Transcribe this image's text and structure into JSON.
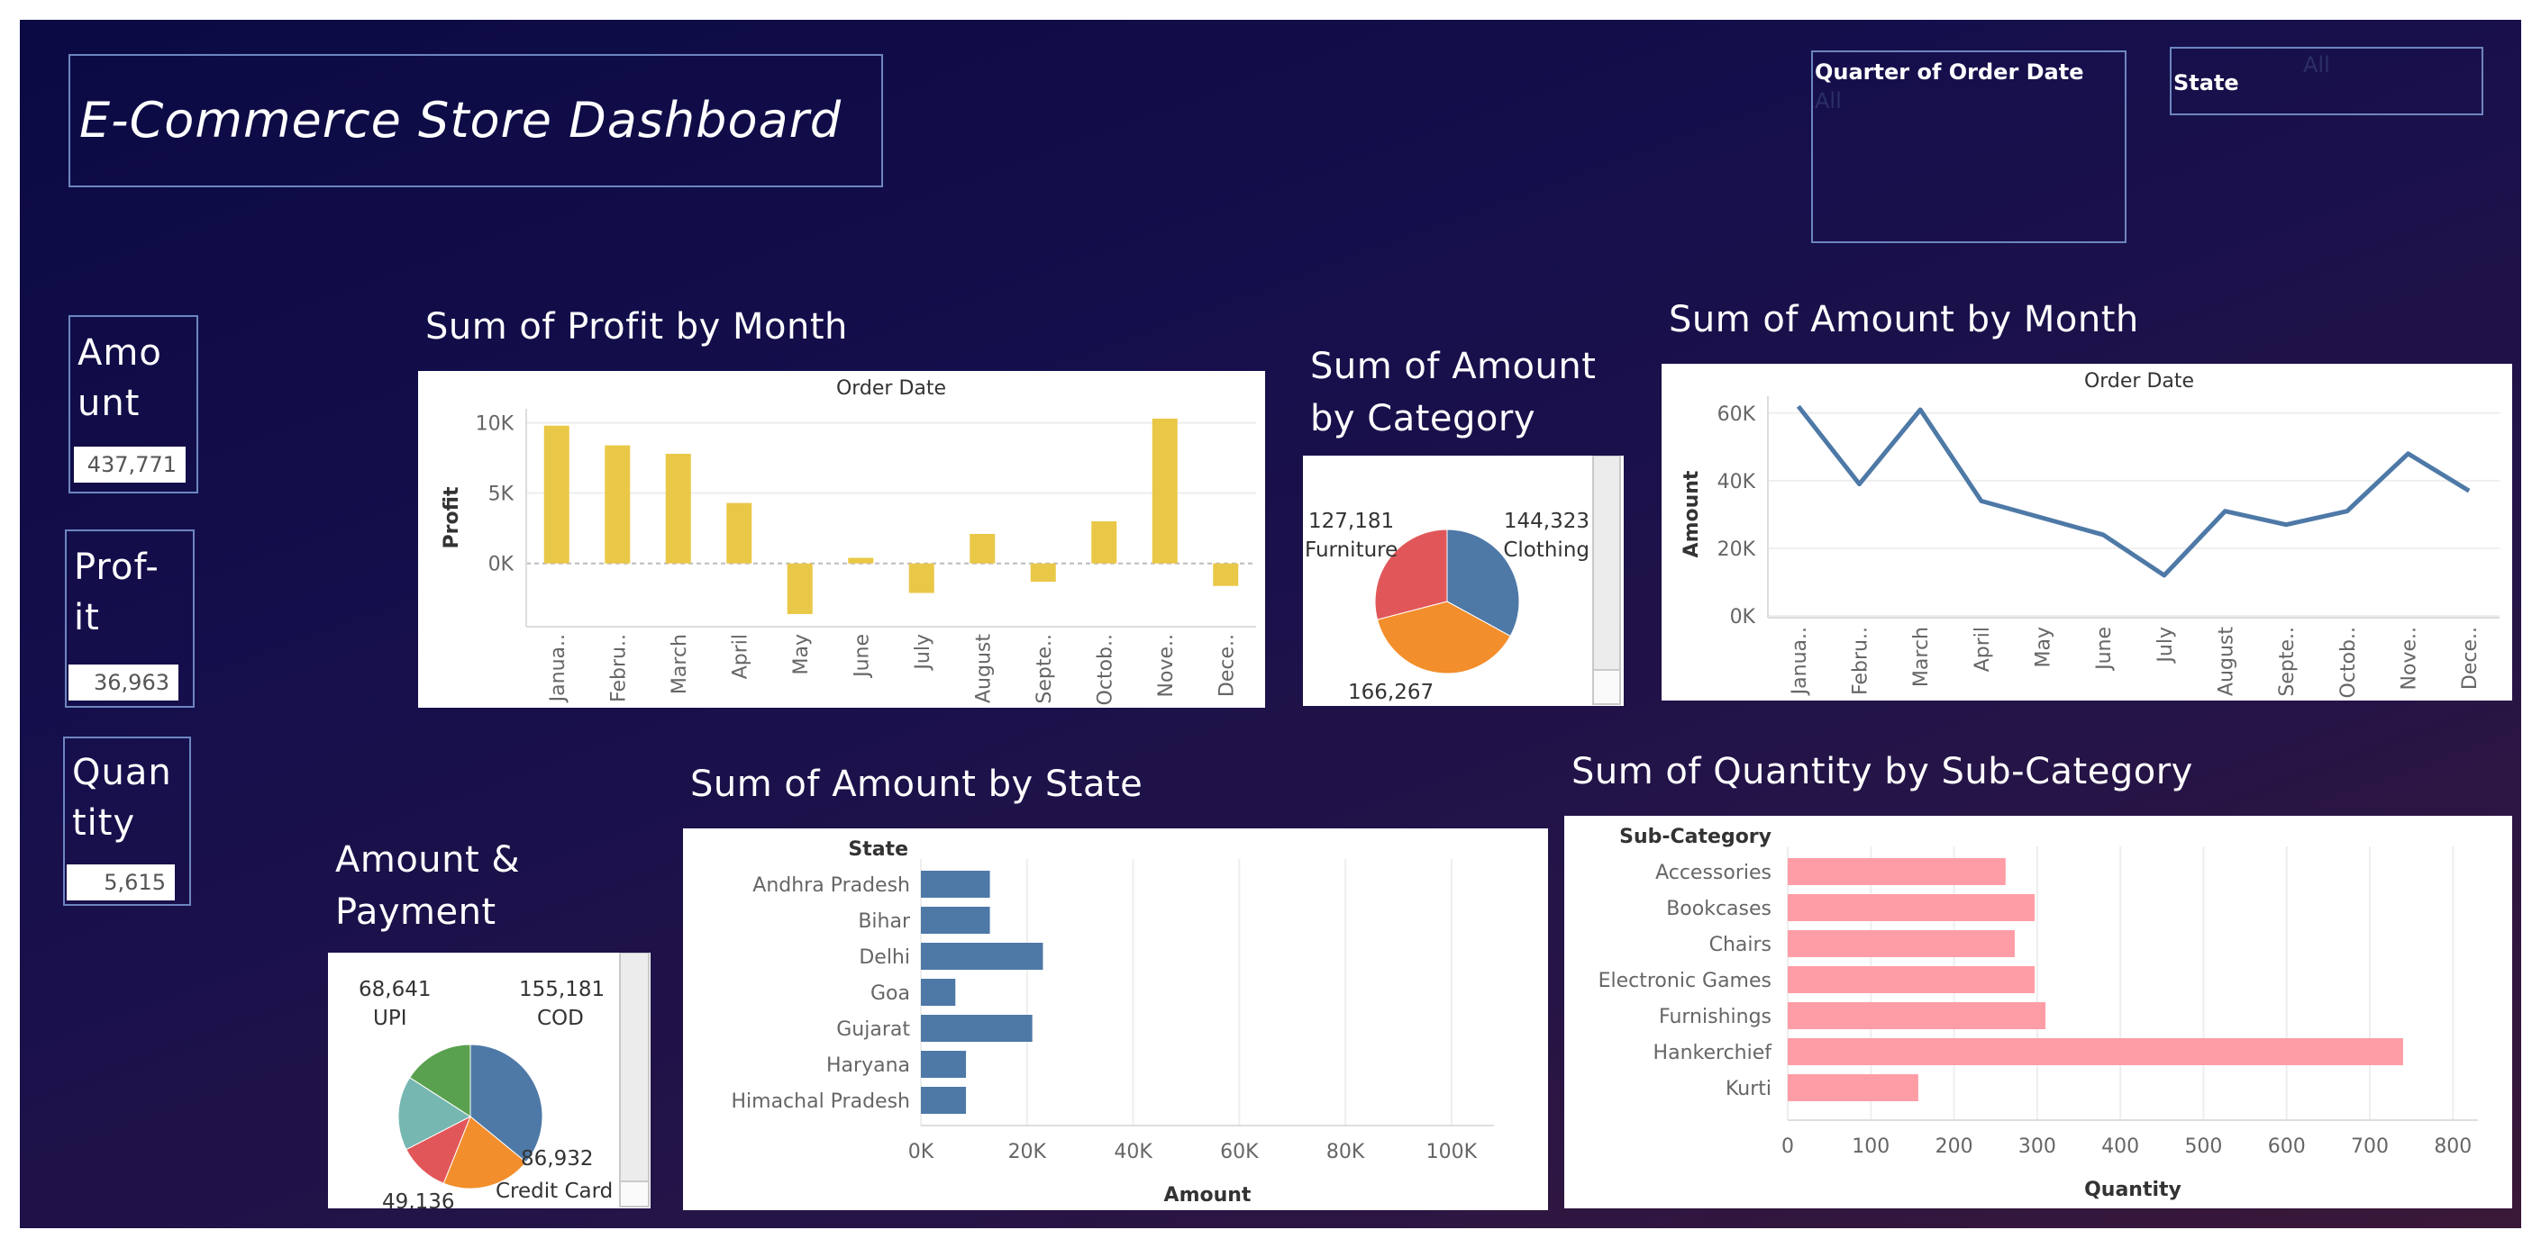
{
  "header": {
    "title": "E-Commerce Store Dashboard",
    "filters": [
      {
        "label": "Quarter of Order Date",
        "value": "All"
      },
      {
        "label": "State",
        "value": "All"
      }
    ]
  },
  "kpis": [
    {
      "label": "Amo\nunt",
      "value": "437,771"
    },
    {
      "label": "Prof-\nit",
      "value": "36,963"
    },
    {
      "label": "Quan\ntity",
      "value": "5,615"
    }
  ],
  "colors": {
    "yellow": "#eac847",
    "blue": "#4e79a7",
    "pink": "#ff9da7",
    "red": "#e15759",
    "orange": "#f28e2b",
    "green": "#59a14f",
    "teal": "#76b7b2"
  },
  "chart_data": [
    {
      "id": "profit_by_month",
      "type": "bar",
      "title": "Sum of Profit by Month",
      "xlabel": "Order Date",
      "ylabel": "Profit",
      "categories": [
        "Janua..",
        "Febru..",
        "March",
        "April",
        "May",
        "June",
        "July",
        "August",
        "Septe..",
        "Octob..",
        "Nove..",
        "Dece.."
      ],
      "values": [
        9800,
        8400,
        7800,
        4300,
        -3600,
        400,
        -2100,
        2100,
        -1300,
        3000,
        10300,
        -1600
      ],
      "yticks": [
        "10K",
        "5K",
        "0K"
      ],
      "ylim": [
        -4500,
        11000
      ],
      "color": "#eac847"
    },
    {
      "id": "amount_by_category",
      "type": "pie",
      "title": "Sum of Amount\nby Category",
      "slices": [
        {
          "label": "Clothing",
          "value": 144323,
          "value_text": "144,323",
          "color": "#4e79a7"
        },
        {
          "label": "",
          "value": 166267,
          "value_text": "166,267",
          "color": "#f28e2b"
        },
        {
          "label": "Furniture",
          "value": 127181,
          "value_text": "127,181",
          "color": "#e15759"
        }
      ]
    },
    {
      "id": "amount_by_month",
      "type": "line",
      "title": "Sum of Amount by Month",
      "xlabel": "Order Date",
      "ylabel": "Amount",
      "categories": [
        "Janua..",
        "Febru..",
        "March",
        "April",
        "May",
        "June",
        "July",
        "August",
        "Septe..",
        "Octob..",
        "Nove..",
        "Dece.."
      ],
      "values": [
        62000,
        39000,
        61000,
        34000,
        29000,
        24000,
        12000,
        31000,
        27000,
        31000,
        48000,
        37000
      ],
      "yticks": [
        "60K",
        "40K",
        "20K",
        "0K"
      ],
      "ylim": [
        0,
        65000
      ],
      "color": "#4e79a7"
    },
    {
      "id": "amount_and_payment",
      "type": "pie",
      "title": "Amount &\nPayment",
      "slices": [
        {
          "label": "COD",
          "value": 155181,
          "value_text": "155,181",
          "color": "#4e79a7"
        },
        {
          "label": "Credit Card",
          "value": 86932,
          "value_text": "86,932",
          "color": "#f28e2b"
        },
        {
          "label": "",
          "value": 49136,
          "value_text": "49,136",
          "color": "#e15759"
        },
        {
          "label": "",
          "value": 72000,
          "value_text": "",
          "color": "#76b7b2"
        },
        {
          "label": "UPI",
          "value": 68641,
          "value_text": "68,641",
          "color": "#59a14f"
        }
      ]
    },
    {
      "id": "amount_by_state",
      "type": "bar",
      "orientation": "horizontal",
      "title": "Sum of Amount by State",
      "dimension_header": "State",
      "xlabel": "Amount",
      "categories": [
        "Andhra Pradesh",
        "Bihar",
        "Delhi",
        "Goa",
        "Gujarat",
        "Haryana",
        "Himachal Pradesh"
      ],
      "values": [
        13000,
        13000,
        23000,
        6500,
        21000,
        8500,
        8500
      ],
      "xticks": [
        "0K",
        "20K",
        "40K",
        "60K",
        "80K",
        "100K"
      ],
      "xlim": [
        0,
        108000
      ],
      "color": "#4e79a7"
    },
    {
      "id": "quantity_by_subcategory",
      "type": "bar",
      "orientation": "horizontal",
      "title": "Sum of Quantity by Sub-Category",
      "dimension_header": "Sub-Category",
      "xlabel": "Quantity",
      "categories": [
        "Accessories",
        "Bookcases",
        "Chairs",
        "Electronic Games",
        "Furnishings",
        "Hankerchief",
        "Kurti"
      ],
      "values": [
        262,
        297,
        273,
        297,
        310,
        740,
        157
      ],
      "xticks": [
        "0",
        "100",
        "200",
        "300",
        "400",
        "500",
        "600",
        "700",
        "800"
      ],
      "xlim": [
        0,
        830
      ],
      "color": "#ff9da7"
    }
  ]
}
